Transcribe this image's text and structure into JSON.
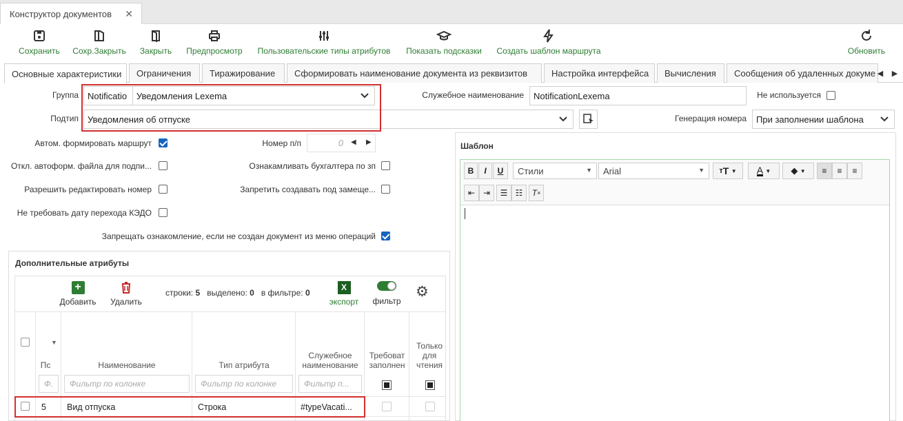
{
  "window": {
    "tab_title": "Конструктор документов",
    "close": "✕"
  },
  "toolbar": {
    "save": "Сохранить",
    "save_close": "Сохр.Закрыть",
    "close": "Закрыть",
    "preview": "Предпросмотр",
    "custom_types": "Пользовательские типы атрибутов",
    "show_hints": "Показать подсказки",
    "route_template": "Создать шаблон маршрута",
    "refresh": "Обновить"
  },
  "tabs": [
    "Основные характеристики",
    "Ограничения",
    "Тиражирование",
    "Сформировать наименование документа из реквизитов",
    "Настройка интерфейса",
    "Вычисления",
    "Сообщения об удаленных докуме"
  ],
  "form": {
    "group_label": "Группа",
    "group_code": "Notificatio",
    "group_value": "Уведомления Lexema",
    "subtype_label": "Подтип",
    "subtype_value": "Уведомления об отпуске",
    "service_name_label": "Служебное наименование",
    "service_name_value": "NotificationLexema",
    "not_used_label": "Не используется",
    "numgen_label": "Генерация номера",
    "numgen_value": "При заполнении шаблона",
    "auto_route_label": "Автом. формировать маршрут",
    "num_label": "Номер п/п",
    "num_value": "0",
    "disable_autoform_label": "Откл. автоформ. файла для подпи...",
    "acquaint_accountant_label": "Ознакамливать бухгалтера по зп",
    "allow_edit_number_label": "Разрешить редактировать номер",
    "forbid_deputy_label": "Запретить создавать под замеще...",
    "no_kedo_date_label": "Не требовать дату перехода КЭДО",
    "forbid_acquaint_label": "Запрещать ознакомление, если не создан документ из меню операций"
  },
  "template": {
    "title": "Шаблон",
    "bold": "B",
    "italic": "I",
    "underline": "U",
    "styles": "Стили",
    "font": "Arial"
  },
  "attributes": {
    "title": "Дополнительные атрибуты",
    "add": "Добавить",
    "delete": "Удалить",
    "rows_label": "строки:",
    "rows_value": "5",
    "selected_label": "выделено:",
    "selected_value": "0",
    "filtered_label": "в фильтре:",
    "filtered_value": "0",
    "export": "экспорт",
    "filter": "фильтр",
    "columns": {
      "pos": "Пс",
      "name": "Наименование",
      "type": "Тип атрибута",
      "service1": "Служебное",
      "service2": "наименование",
      "required1": "Требоват",
      "required2": "заполнен",
      "readonly1": "Только",
      "readonly2": "для",
      "readonly3": "чтения"
    },
    "filters": {
      "pos": "Ф.",
      "name": "Фильтр по колонке",
      "type": "Фильтр по колонке",
      "service": "Фильтр п..."
    },
    "rows": [
      {
        "pos": "5",
        "name": "Вид отпуска",
        "type": "Строка",
        "service": "#typeVacati..."
      }
    ]
  }
}
